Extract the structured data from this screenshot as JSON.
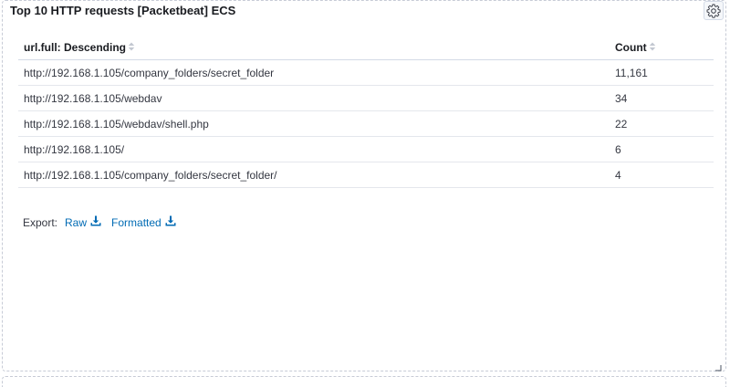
{
  "panel": {
    "title": "Top 10 HTTP requests [Packetbeat] ECS",
    "settings_icon": "gear-icon"
  },
  "table": {
    "columns": [
      {
        "label": "url.full: Descending",
        "sort_icon": "sort-icon"
      },
      {
        "label": "Count",
        "sort_icon": "sort-icon"
      }
    ],
    "rows": [
      {
        "url": "http://192.168.1.105/company_folders/secret_folder",
        "count": "11,161"
      },
      {
        "url": "http://192.168.1.105/webdav",
        "count": "34"
      },
      {
        "url": "http://192.168.1.105/webdav/shell.php",
        "count": "22"
      },
      {
        "url": "http://192.168.1.105/",
        "count": "6"
      },
      {
        "url": "http://192.168.1.105/company_folders/secret_folder/",
        "count": "4"
      }
    ]
  },
  "export": {
    "label": "Export:",
    "raw_label": "Raw",
    "formatted_label": "Formatted",
    "icon": "download-icon"
  },
  "colors": {
    "link": "#006bb4",
    "border": "#d3dae6",
    "text": "#343741"
  }
}
